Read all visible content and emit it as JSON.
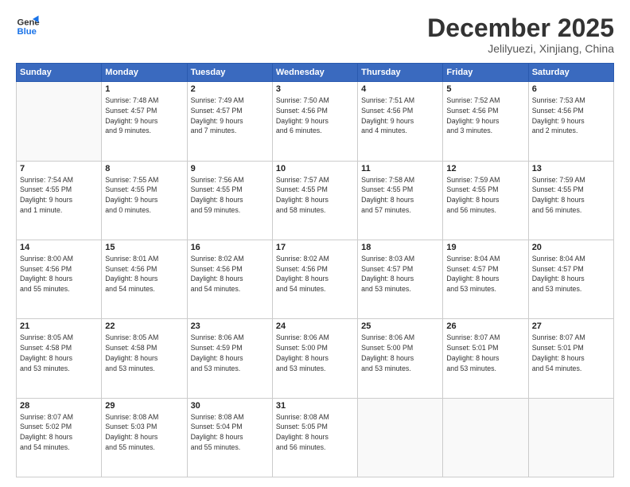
{
  "logo": {
    "line1": "General",
    "line2": "Blue"
  },
  "title": "December 2025",
  "subtitle": "Jelilyuezi, Xinjiang, China",
  "weekdays": [
    "Sunday",
    "Monday",
    "Tuesday",
    "Wednesday",
    "Thursday",
    "Friday",
    "Saturday"
  ],
  "weeks": [
    [
      {
        "day": "",
        "detail": ""
      },
      {
        "day": "1",
        "detail": "Sunrise: 7:48 AM\nSunset: 4:57 PM\nDaylight: 9 hours\nand 9 minutes."
      },
      {
        "day": "2",
        "detail": "Sunrise: 7:49 AM\nSunset: 4:57 PM\nDaylight: 9 hours\nand 7 minutes."
      },
      {
        "day": "3",
        "detail": "Sunrise: 7:50 AM\nSunset: 4:56 PM\nDaylight: 9 hours\nand 6 minutes."
      },
      {
        "day": "4",
        "detail": "Sunrise: 7:51 AM\nSunset: 4:56 PM\nDaylight: 9 hours\nand 4 minutes."
      },
      {
        "day": "5",
        "detail": "Sunrise: 7:52 AM\nSunset: 4:56 PM\nDaylight: 9 hours\nand 3 minutes."
      },
      {
        "day": "6",
        "detail": "Sunrise: 7:53 AM\nSunset: 4:56 PM\nDaylight: 9 hours\nand 2 minutes."
      }
    ],
    [
      {
        "day": "7",
        "detail": "Sunrise: 7:54 AM\nSunset: 4:55 PM\nDaylight: 9 hours\nand 1 minute."
      },
      {
        "day": "8",
        "detail": "Sunrise: 7:55 AM\nSunset: 4:55 PM\nDaylight: 9 hours\nand 0 minutes."
      },
      {
        "day": "9",
        "detail": "Sunrise: 7:56 AM\nSunset: 4:55 PM\nDaylight: 8 hours\nand 59 minutes."
      },
      {
        "day": "10",
        "detail": "Sunrise: 7:57 AM\nSunset: 4:55 PM\nDaylight: 8 hours\nand 58 minutes."
      },
      {
        "day": "11",
        "detail": "Sunrise: 7:58 AM\nSunset: 4:55 PM\nDaylight: 8 hours\nand 57 minutes."
      },
      {
        "day": "12",
        "detail": "Sunrise: 7:59 AM\nSunset: 4:55 PM\nDaylight: 8 hours\nand 56 minutes."
      },
      {
        "day": "13",
        "detail": "Sunrise: 7:59 AM\nSunset: 4:55 PM\nDaylight: 8 hours\nand 56 minutes."
      }
    ],
    [
      {
        "day": "14",
        "detail": "Sunrise: 8:00 AM\nSunset: 4:56 PM\nDaylight: 8 hours\nand 55 minutes."
      },
      {
        "day": "15",
        "detail": "Sunrise: 8:01 AM\nSunset: 4:56 PM\nDaylight: 8 hours\nand 54 minutes."
      },
      {
        "day": "16",
        "detail": "Sunrise: 8:02 AM\nSunset: 4:56 PM\nDaylight: 8 hours\nand 54 minutes."
      },
      {
        "day": "17",
        "detail": "Sunrise: 8:02 AM\nSunset: 4:56 PM\nDaylight: 8 hours\nand 54 minutes."
      },
      {
        "day": "18",
        "detail": "Sunrise: 8:03 AM\nSunset: 4:57 PM\nDaylight: 8 hours\nand 53 minutes."
      },
      {
        "day": "19",
        "detail": "Sunrise: 8:04 AM\nSunset: 4:57 PM\nDaylight: 8 hours\nand 53 minutes."
      },
      {
        "day": "20",
        "detail": "Sunrise: 8:04 AM\nSunset: 4:57 PM\nDaylight: 8 hours\nand 53 minutes."
      }
    ],
    [
      {
        "day": "21",
        "detail": "Sunrise: 8:05 AM\nSunset: 4:58 PM\nDaylight: 8 hours\nand 53 minutes."
      },
      {
        "day": "22",
        "detail": "Sunrise: 8:05 AM\nSunset: 4:58 PM\nDaylight: 8 hours\nand 53 minutes."
      },
      {
        "day": "23",
        "detail": "Sunrise: 8:06 AM\nSunset: 4:59 PM\nDaylight: 8 hours\nand 53 minutes."
      },
      {
        "day": "24",
        "detail": "Sunrise: 8:06 AM\nSunset: 5:00 PM\nDaylight: 8 hours\nand 53 minutes."
      },
      {
        "day": "25",
        "detail": "Sunrise: 8:06 AM\nSunset: 5:00 PM\nDaylight: 8 hours\nand 53 minutes."
      },
      {
        "day": "26",
        "detail": "Sunrise: 8:07 AM\nSunset: 5:01 PM\nDaylight: 8 hours\nand 53 minutes."
      },
      {
        "day": "27",
        "detail": "Sunrise: 8:07 AM\nSunset: 5:01 PM\nDaylight: 8 hours\nand 54 minutes."
      }
    ],
    [
      {
        "day": "28",
        "detail": "Sunrise: 8:07 AM\nSunset: 5:02 PM\nDaylight: 8 hours\nand 54 minutes."
      },
      {
        "day": "29",
        "detail": "Sunrise: 8:08 AM\nSunset: 5:03 PM\nDaylight: 8 hours\nand 55 minutes."
      },
      {
        "day": "30",
        "detail": "Sunrise: 8:08 AM\nSunset: 5:04 PM\nDaylight: 8 hours\nand 55 minutes."
      },
      {
        "day": "31",
        "detail": "Sunrise: 8:08 AM\nSunset: 5:05 PM\nDaylight: 8 hours\nand 56 minutes."
      },
      {
        "day": "",
        "detail": ""
      },
      {
        "day": "",
        "detail": ""
      },
      {
        "day": "",
        "detail": ""
      }
    ]
  ]
}
